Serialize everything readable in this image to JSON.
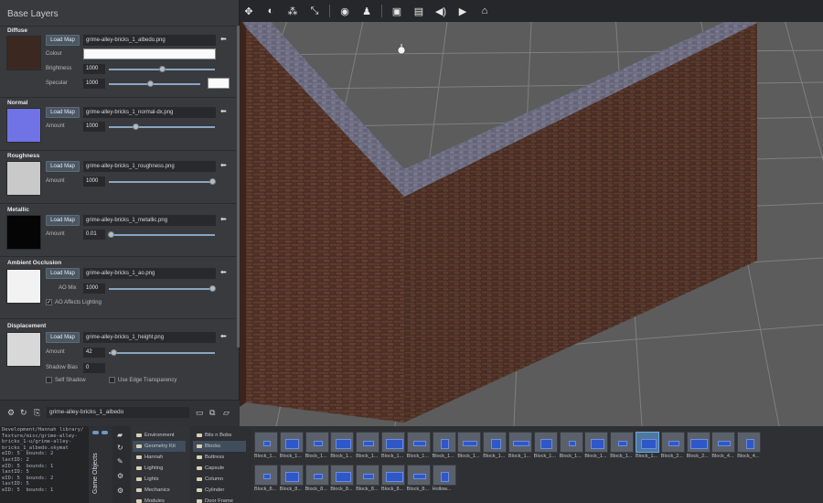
{
  "panel": {
    "title": "Base Layers",
    "load_map_label": "Load Map",
    "sections": {
      "diffuse": {
        "title": "Diffuse",
        "file": "grime-alley-bricks_1_albedo.png",
        "colour_label": "Colour",
        "brightness_label": "Brightness",
        "brightness_value": "1000",
        "brightness_level": 0.5,
        "specular_label": "Specular",
        "specular_value": "1000",
        "specular_level": 0.45
      },
      "normal": {
        "title": "Normal",
        "file": "grime-alley-bricks_1_normal-dx.png",
        "amount_label": "Amount",
        "amount_value": "1000",
        "amount_level": 0.25
      },
      "roughness": {
        "title": "Roughness",
        "file": "grime-alley-bricks_1_roughness.png",
        "amount_label": "Amount",
        "amount_value": "1000",
        "amount_level": 0.97
      },
      "metallic": {
        "title": "Metallic",
        "file": "grime-alley-bricks_1_metallic.png",
        "amount_label": "Amount",
        "amount_value": "0.01",
        "amount_level": 0.02
      },
      "ao": {
        "title": "Ambient Occlusion",
        "file": "grime-alley-bricks_1_ao.png",
        "mix_label": "AO Mix",
        "mix_value": "1000",
        "mix_level": 0.97,
        "affects_label": "AO Affects Lighting",
        "affects_checked": true
      },
      "displacement": {
        "title": "Displacement",
        "file": "grime-alley-bricks_1_height.png",
        "amount_label": "Amount",
        "amount_value": "42",
        "amount_level": 0.04,
        "bias_label": "Shadow Bias",
        "bias_value": "0",
        "self_shadow_label": "Self Shadow",
        "edge_label": "Use Edge Transparency"
      }
    },
    "footer_name": "grime-alley-bricks_1_albedo"
  },
  "toolbar": {
    "icons": [
      "move-icon",
      "globe-icon",
      "snap-icon",
      "transform-icon",
      "eye-icon",
      "camera-icon",
      "frame-icon",
      "layout-icon",
      "sound-icon",
      "play-icon",
      "gamepad-icon"
    ]
  },
  "console": {
    "lines": [
      "Development/Hannah library/",
      "Texture/misc/grime-alley-",
      "bricks_1-u/grime-alley-",
      "bricks_1_albedo.skymat",
      "eID: 5  bounds: 2",
      "lastID: 2",
      "eID: 5  bounds: 1",
      "lastID: 5",
      "eID: 5  bounds: 2",
      "lastID: 5",
      "eID: 5  bounds: 1"
    ]
  },
  "bottom": {
    "tab_label": "Game Objects",
    "folders_left": [
      "Environment",
      "Geometry Kit",
      "Hannah",
      "Lighting",
      "Lights",
      "Mechanics",
      "Modules"
    ],
    "folders_left_active": 1,
    "folders_right": [
      "Bits n Bobs",
      "Blocks",
      "Buttress",
      "Capsule",
      "Column",
      "Cylinder",
      "Door Frame"
    ],
    "folders_right_active": 1,
    "assets_row1": [
      "Block_1...",
      "Block_1...",
      "Block_1...",
      "Block_1...",
      "Block_1...",
      "Block_1...",
      "Block_1...",
      "Block_1...",
      "Block_1...",
      "Block_1...",
      "Block_1...",
      "Block_1...",
      "Block_1...",
      "Block_1...",
      "Block_1...",
      "Block_1...",
      "Block_2...",
      "Block_2...",
      "Block_4...",
      "Block_4..."
    ],
    "assets_row1_selected": 15,
    "assets_row2": [
      "Block_8...",
      "Block_8...",
      "Block_8...",
      "Block_8...",
      "Block_8...",
      "Block_8...",
      "Block_8...",
      "Hollow..."
    ]
  },
  "colors": {
    "accent": "#4a5663",
    "selection": "#3f4d5c",
    "brick": "#5a3a2e",
    "grid": "#8e8e8e"
  }
}
